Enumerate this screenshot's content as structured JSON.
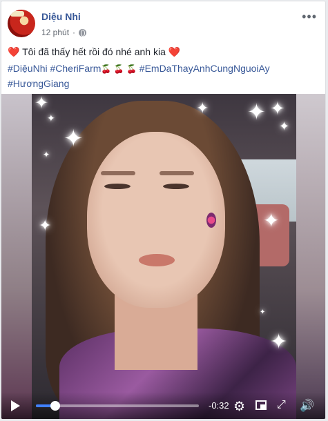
{
  "post": {
    "author": "Diệu Nhi",
    "time": "12 phút",
    "more_icon": "more-options-icon",
    "text_prefix": "❤️",
    "text_body": " Tôi đã thấy hết rồi đó nhé anh kia ",
    "text_suffix": "❤️",
    "hashtags": [
      {
        "label": "#DiệuNhi"
      },
      {
        "label": "#CheriFarm"
      },
      {
        "label": "#EmDaThayAnhCungNguoiAy"
      },
      {
        "label": "#HươngGiang"
      }
    ],
    "cherries": "🍒 🍒 🍒"
  },
  "video": {
    "time_remaining": "-0:32",
    "progress": 0.12
  },
  "colors": {
    "link": "#385898",
    "progress": "#4080ff"
  }
}
